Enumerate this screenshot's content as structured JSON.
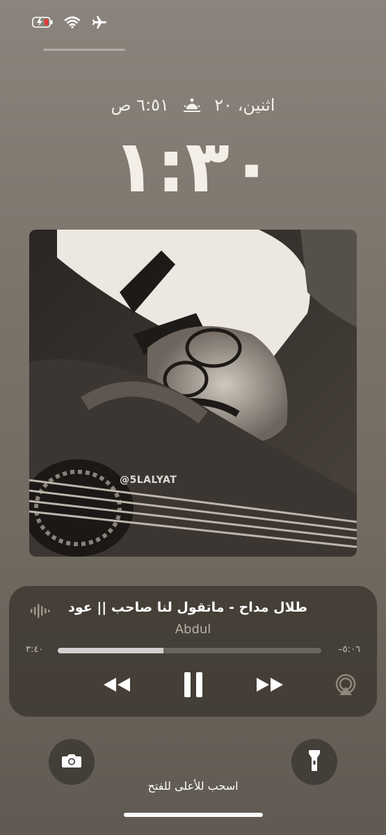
{
  "status_bar": {
    "icons": [
      "battery-low-charging-icon",
      "wifi-icon",
      "airplane-mode-icon"
    ],
    "battery_color": "#e03a33"
  },
  "lock_screen": {
    "date_text": "اثنين، ٢٠",
    "sunrise_time": "٦:٥١ ص",
    "clock": "١:٣٠"
  },
  "now_playing": {
    "artwork_watermark": "@5LALYAT",
    "title": "طلال مداح - ماتقول لنا صاحب || عود",
    "artist": "Abdul",
    "elapsed": "٣:٤٠",
    "remaining": "–٥:٠٦",
    "progress": 0.4,
    "controls": [
      "rewind-icon",
      "pause-icon",
      "fast-forward-icon",
      "airplay-icon"
    ]
  },
  "bottom": {
    "swipe_hint": "اسحب للأعلى للفتح",
    "left_button": "camera-icon",
    "right_button": "flashlight-icon"
  }
}
